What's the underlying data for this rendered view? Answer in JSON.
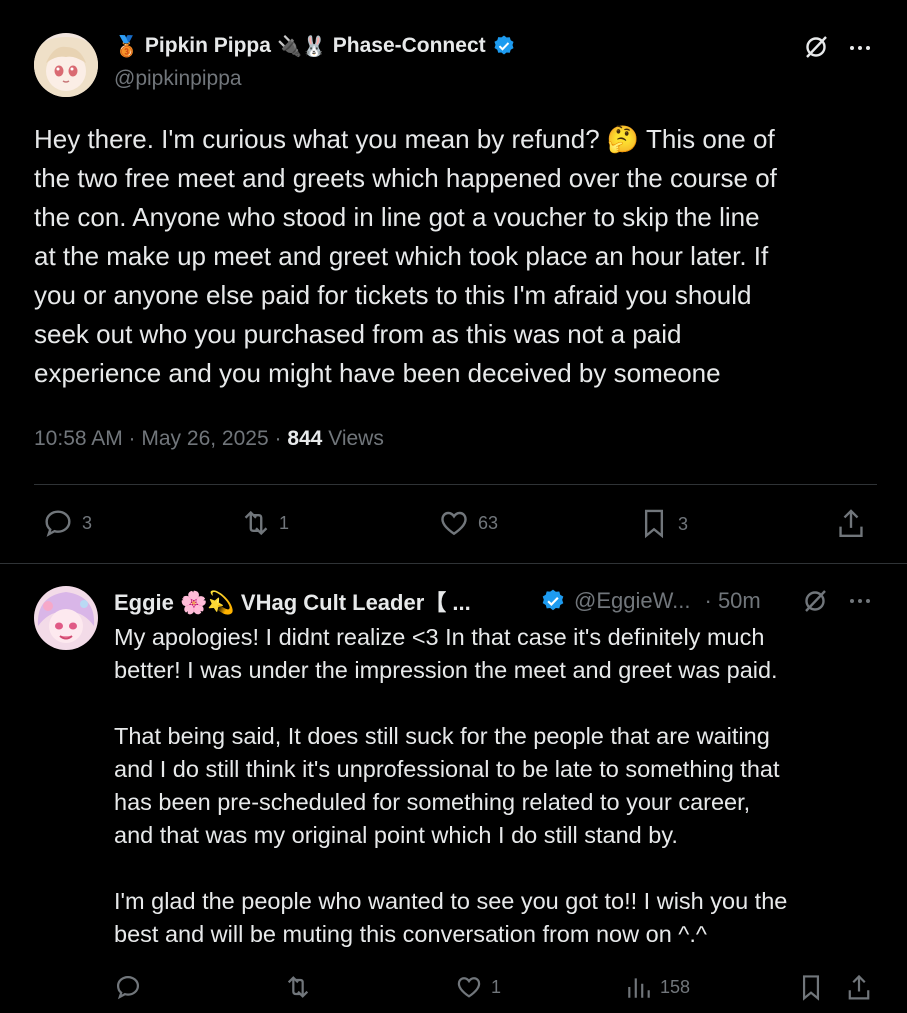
{
  "main_tweet": {
    "display_name": "Pipkin Pippa",
    "emoji_prefix": "🥉",
    "emoji_mid": "🔌🐰",
    "affiliation": "Phase-Connect",
    "handle": "@pipkinpippa",
    "text_lines": [
      "Hey there. I'm curious what you mean by refund? 🤔 This one of",
      "the two free meet and greets which happened over the course of",
      "the con. Anyone who stood in line got a voucher to skip the line",
      "at the make up meet and greet which took place an hour later. If",
      "you or anyone else paid for tickets to this I'm afraid you should",
      "seek out who you purchased from as this was not a paid",
      "experience and you might have been deceived by someone"
    ],
    "time": "10:58 AM · May 26, 2025 · ",
    "views_count": "844",
    "views_label": " Views",
    "actions": {
      "replies": "3",
      "reposts": "1",
      "likes": "63",
      "bookmarks": "3"
    }
  },
  "reply_tweet": {
    "display_name": "Eggie 🌸💫 VHag Cult Leader【 ...",
    "handle": "@EggieW...",
    "age": "· 50m",
    "paragraphs": [
      [
        "My apologies! I didnt realize <3 In that case it's definitely  much",
        "better! I was under the impression the meet and greet was paid."
      ],
      [
        "That being said, It does still suck for the people that are waiting",
        "and I do still think it's unprofessional to be late to something that",
        "has been pre-scheduled for something related to your career,",
        "and that was my original point which I do still stand by."
      ],
      [
        "I'm glad the people who wanted to see you got to!! I wish you the",
        "best and will be muting this conversation from now on ^.^"
      ]
    ],
    "actions": {
      "replies": "",
      "reposts": "",
      "likes": "1",
      "views": "158"
    }
  },
  "colors": {
    "background": "#000000",
    "text": "#e7e9ea",
    "muted": "#71767b",
    "verified": "#1d9bf0",
    "divider": "#2f3336"
  }
}
